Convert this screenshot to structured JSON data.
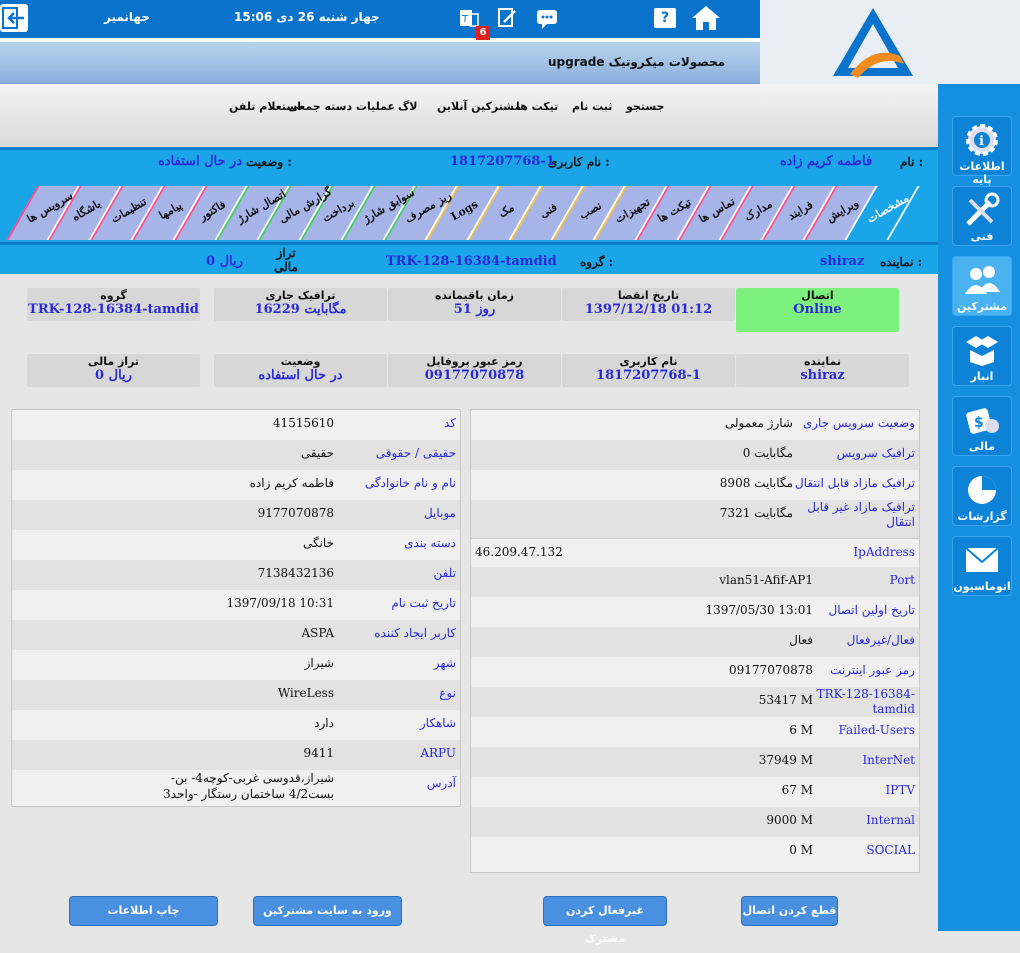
{
  "topbar": {
    "user": "جهانمیر",
    "datetime": "جهار شنبه 26 دی 15:06",
    "notification_count": "6",
    "banner": "upgrade محصولات میکروتیک"
  },
  "sidebar": {
    "items": [
      {
        "label": "اطلاعات پایه",
        "icon": "info-gear-icon"
      },
      {
        "label": "فنی",
        "icon": "tools-icon"
      },
      {
        "label": "مشترکین",
        "icon": "users-icon"
      },
      {
        "label": "انبار",
        "icon": "boxes-icon"
      },
      {
        "label": "مالی",
        "icon": "money-icon"
      },
      {
        "label": "گزارشات",
        "icon": "pie-chart-icon"
      },
      {
        "label": "اتوماسیون",
        "icon": "envelope-icon"
      }
    ]
  },
  "menu": {
    "items": [
      "جستجو",
      "ثبت نام",
      "تیکت ها",
      "مشترکین آنلاین",
      "لاگ",
      "عملیات دسته جمعی",
      "استعلام تلفن"
    ]
  },
  "info": {
    "name_label": "نام :",
    "name": "فاطمه کریم زاده",
    "username_label": "نام کاربری :",
    "username": "1817207768-1",
    "status_label": "وضعیت :",
    "status": "در حال استفاده",
    "agent_label": "نماینده :",
    "agent": "shiraz",
    "group_label": "گروه :",
    "group": "TRK-128-16384-tamdid",
    "balance_label": "تراز مالی",
    "balance": "0 ریال"
  },
  "tabs": [
    "مشخصات",
    "ویرایش",
    "فرایند",
    "مدارک",
    "تماس ها",
    "تیکت ها",
    "تجهیزات",
    "نصب",
    "فنی",
    "مک",
    "Logs",
    "ریز مصرف",
    "سوابق شارژ",
    "برداخت",
    "گزارش مالی",
    "اتصال شارژ",
    "فاکتور",
    "پیامها",
    "تنظیمات",
    "باشگاه",
    "سرویس ها"
  ],
  "cards_row1": [
    {
      "label": "اتصال",
      "value": "Online"
    },
    {
      "label": "تاریخ انقضا",
      "value": "1397/12/18 01:12"
    },
    {
      "label": "زمان باقیمانده",
      "value": "51 روز"
    },
    {
      "label": "ترافیک جاری",
      "value": "16229 مگابایت"
    },
    {
      "label": "گروه",
      "value": "TRK-128-16384-tamdid"
    }
  ],
  "cards_row2": [
    {
      "label": "نماینده",
      "value": "shiraz"
    },
    {
      "label": "نام کاربری",
      "value": "1817207768-1"
    },
    {
      "label": "رمز عبور پروفایل",
      "value": "09177070878"
    },
    {
      "label": "وضعیت",
      "value": "در حال استفاده"
    },
    {
      "label": "تراز مالی",
      "value": "0 ریال"
    }
  ],
  "right_top": [
    {
      "k": "وضعیت سرویس جاری",
      "v": "شارژ معمولی"
    },
    {
      "k": "ترافیک سرویس",
      "v": "0 مگابایت"
    },
    {
      "k": "ترافیک مازاد قابل انتقال",
      "v": "8908 مگابایت"
    },
    {
      "k": "ترافیک مازاد غیر قابل انتقال",
      "v": "7321 مگابایت"
    }
  ],
  "right_bottom": [
    {
      "k": "IpAddress",
      "v": "46.209.47.132"
    },
    {
      "k": "Port",
      "v": "vlan51-Afif-AP1"
    },
    {
      "k": "تاریخ اولین اتصال",
      "v": "1397/05/30 13:01"
    },
    {
      "k": "فعال/غیرفعال",
      "v": "فعال"
    },
    {
      "k": "رمز عبور اینترنت",
      "v": "09177070878"
    },
    {
      "k": "TRK-128-16384-tamdid",
      "v": "53417 M"
    },
    {
      "k": "Failed-Users",
      "v": "6 M"
    },
    {
      "k": "InterNet",
      "v": "37949 M"
    },
    {
      "k": "IPTV",
      "v": "67 M"
    },
    {
      "k": "Internal",
      "v": "9000 M"
    },
    {
      "k": "SOCIAL",
      "v": "0 M"
    }
  ],
  "left_panel": [
    {
      "k": "کد",
      "v": "41515610"
    },
    {
      "k": "حقیقی / حقوقی",
      "v": "حقیقی"
    },
    {
      "k": "نام و نام خانوادگی",
      "v": "فاطمه کریم زاده"
    },
    {
      "k": "موبایل",
      "v": "9177070878"
    },
    {
      "k": "دسته بندی",
      "v": "خانگی"
    },
    {
      "k": "تلفن",
      "v": "7138432136"
    },
    {
      "k": "تاریخ ثبت نام",
      "v": "1397/09/18 10:31"
    },
    {
      "k": "کاربر ایجاد کننده",
      "v": "ASPA"
    },
    {
      "k": "شهر",
      "v": "شیراز"
    },
    {
      "k": "نوع",
      "v": "WireLess"
    },
    {
      "k": "شاهکار",
      "v": "دارد"
    },
    {
      "k": "ARPU",
      "v": "9411"
    },
    {
      "k": "آدرس",
      "v": "-شیراز،قدوسی غربی-کوچه4- بن بست4/2 ساختمان رستگار -واحد3"
    }
  ],
  "buttons": {
    "disconnect": "قطع کردن اتصال",
    "deactivate": "غیرفعال کردن مشترک",
    "login_site": "ورود به سایت مشترکین",
    "print": "چاپ اطلاعات"
  },
  "colors": {
    "primary": "#0a73cc",
    "band": "#1aa5e8",
    "value": "#2a2ad6",
    "online": "#7ef07e"
  }
}
